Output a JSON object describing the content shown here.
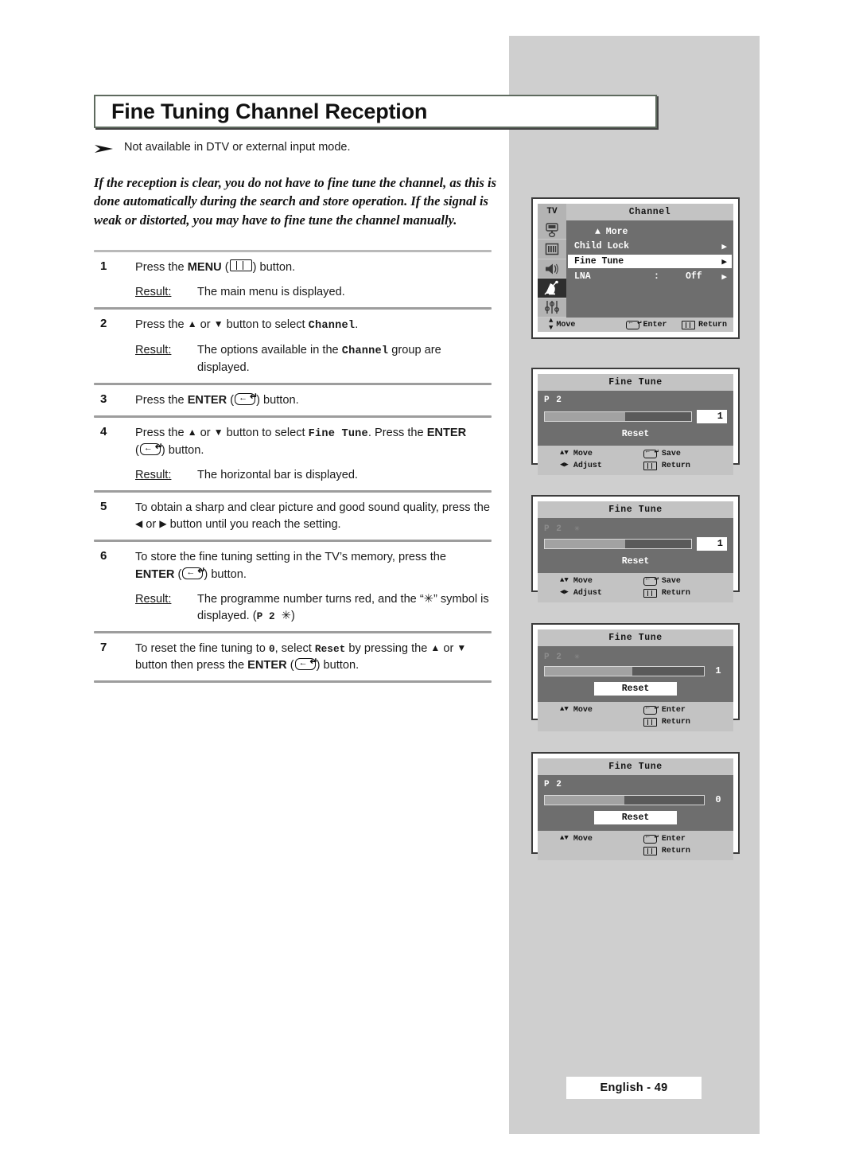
{
  "page": {
    "title": "Fine Tuning Channel Reception",
    "note": "Not available in DTV or external input mode.",
    "intro": "If the reception is clear, you do not have to fine tune the channel, as this is done automatically during the search and store operation. If the signal is weak or distorted, you may have to fine tune the channel manually.",
    "footer": "English - 49"
  },
  "steps": [
    {
      "num": "1",
      "pre": "Press the ",
      "bold": "MENU",
      "icon": "menu-icon",
      "post": " button.",
      "result_label": "Result:",
      "result": "The main menu is displayed."
    },
    {
      "num": "2",
      "pre": "Press the ",
      "mid": " or ",
      "post": " button to select ",
      "mono": "Channel",
      "tail": ".",
      "result_label": "Result:",
      "result_pre": "The options available in the ",
      "result_mono": "Channel",
      "result_post": " group are displayed."
    },
    {
      "num": "3",
      "pre": "Press the ",
      "bold": "ENTER",
      "icon": "enter-icon",
      "post": " button."
    },
    {
      "num": "4",
      "pre": "Press the ",
      "mid": " or ",
      "post": " button to select ",
      "mono": "Fine Tune",
      "tail": ". Press the ",
      "bold": "ENTER",
      "tail2": " button.",
      "result_label": "Result:",
      "result": "The horizontal bar is displayed."
    },
    {
      "num": "5",
      "text_a": "To obtain a sharp and clear picture and good sound quality, press the ",
      "text_b": " or ",
      "text_c": " button until you reach the setting."
    },
    {
      "num": "6",
      "pre": "To store the fine tuning setting in the TV’s memory, press the ",
      "bold": "ENTER",
      "post": " button.",
      "result_label": "Result:",
      "result_a": "The programme number turns red, and the  “",
      "result_sym": "✳",
      "result_b": "” symbol is displayed. (",
      "result_mono": "P 2",
      "result_c": ")"
    },
    {
      "num": "7",
      "text_a": "To reset the fine tuning to ",
      "mono_zero": "0",
      "text_b": ", select ",
      "mono_reset": "Reset",
      "text_c": " by pressing the ",
      "text_d": " or ",
      "text_e": " button then press the ",
      "bold": "ENTER",
      "text_f": " button."
    }
  ],
  "osd": {
    "channel_menu": {
      "tv_label": "TV",
      "title": "Channel",
      "more": "▲ More",
      "rows": [
        {
          "label": "Child Lock",
          "colon": "",
          "value": "",
          "arrow": "▶",
          "highlighted": false
        },
        {
          "label": "Fine Tune",
          "colon": "",
          "value": "",
          "arrow": "▶",
          "highlighted": true
        },
        {
          "label": "LNA",
          "colon": ":",
          "value": "Off",
          "arrow": "▶",
          "highlighted": false
        }
      ],
      "footer": [
        {
          "icon": "up-down-icon",
          "label": "Move"
        },
        {
          "icon": "enter-icon",
          "label": "Enter"
        },
        {
          "icon": "menu-icon",
          "label": "Return"
        }
      ],
      "sidebar_icons": [
        "picture-icon",
        "bars-icon",
        "speaker-icon",
        "satellite-dish-icon",
        "setup-sliders-icon"
      ],
      "selected_sidebar_index": 3
    },
    "fine_tune_panels": [
      {
        "title": "Fine Tune",
        "prog": "P  2",
        "star": "",
        "star_visible": false,
        "prog_red": false,
        "bar_percent": 55,
        "value": "1",
        "value_boxed": true,
        "reset_label": "Reset",
        "reset_highlighted": false,
        "footer": [
          {
            "icon": "up-down-icon",
            "label": "Move"
          },
          {
            "icon": "enter-icon",
            "label": "Save"
          },
          {
            "icon": "left-right-icon",
            "label": "Adjust"
          },
          {
            "icon": "menu-icon",
            "label": "Return"
          }
        ]
      },
      {
        "title": "Fine Tune",
        "prog": "P  2",
        "star": "✳",
        "star_visible": true,
        "prog_red": true,
        "bar_percent": 55,
        "value": "1",
        "value_boxed": true,
        "reset_label": "Reset",
        "reset_highlighted": false,
        "footer": [
          {
            "icon": "up-down-icon",
            "label": "Move"
          },
          {
            "icon": "enter-icon",
            "label": "Save"
          },
          {
            "icon": "left-right-icon",
            "label": "Adjust"
          },
          {
            "icon": "menu-icon",
            "label": "Return"
          }
        ]
      },
      {
        "title": "Fine Tune",
        "prog": "P  2",
        "star": "✳",
        "star_visible": true,
        "prog_red": true,
        "bar_percent": 55,
        "value": "1",
        "value_boxed": false,
        "reset_label": "Reset",
        "reset_highlighted": true,
        "footer": [
          {
            "icon": "up-down-icon",
            "label": "Move"
          },
          {
            "icon": "enter-icon",
            "label": "Enter"
          },
          {
            "icon": "menu-icon",
            "label": "Return"
          }
        ]
      },
      {
        "title": "Fine Tune",
        "prog": "P  2",
        "star": "",
        "star_visible": false,
        "prog_red": false,
        "bar_percent": 50,
        "value": "0",
        "value_boxed": false,
        "reset_label": "Reset",
        "reset_highlighted": true,
        "footer": [
          {
            "icon": "up-down-icon",
            "label": "Move"
          },
          {
            "icon": "enter-icon",
            "label": "Enter"
          },
          {
            "icon": "menu-icon",
            "label": "Return"
          }
        ]
      }
    ]
  },
  "colors": {
    "grey_panel": "#cfcfcf",
    "osd_dark": "#6e6e6e",
    "osd_light": "#c3c3c3",
    "rule": "#b9b9b9"
  }
}
